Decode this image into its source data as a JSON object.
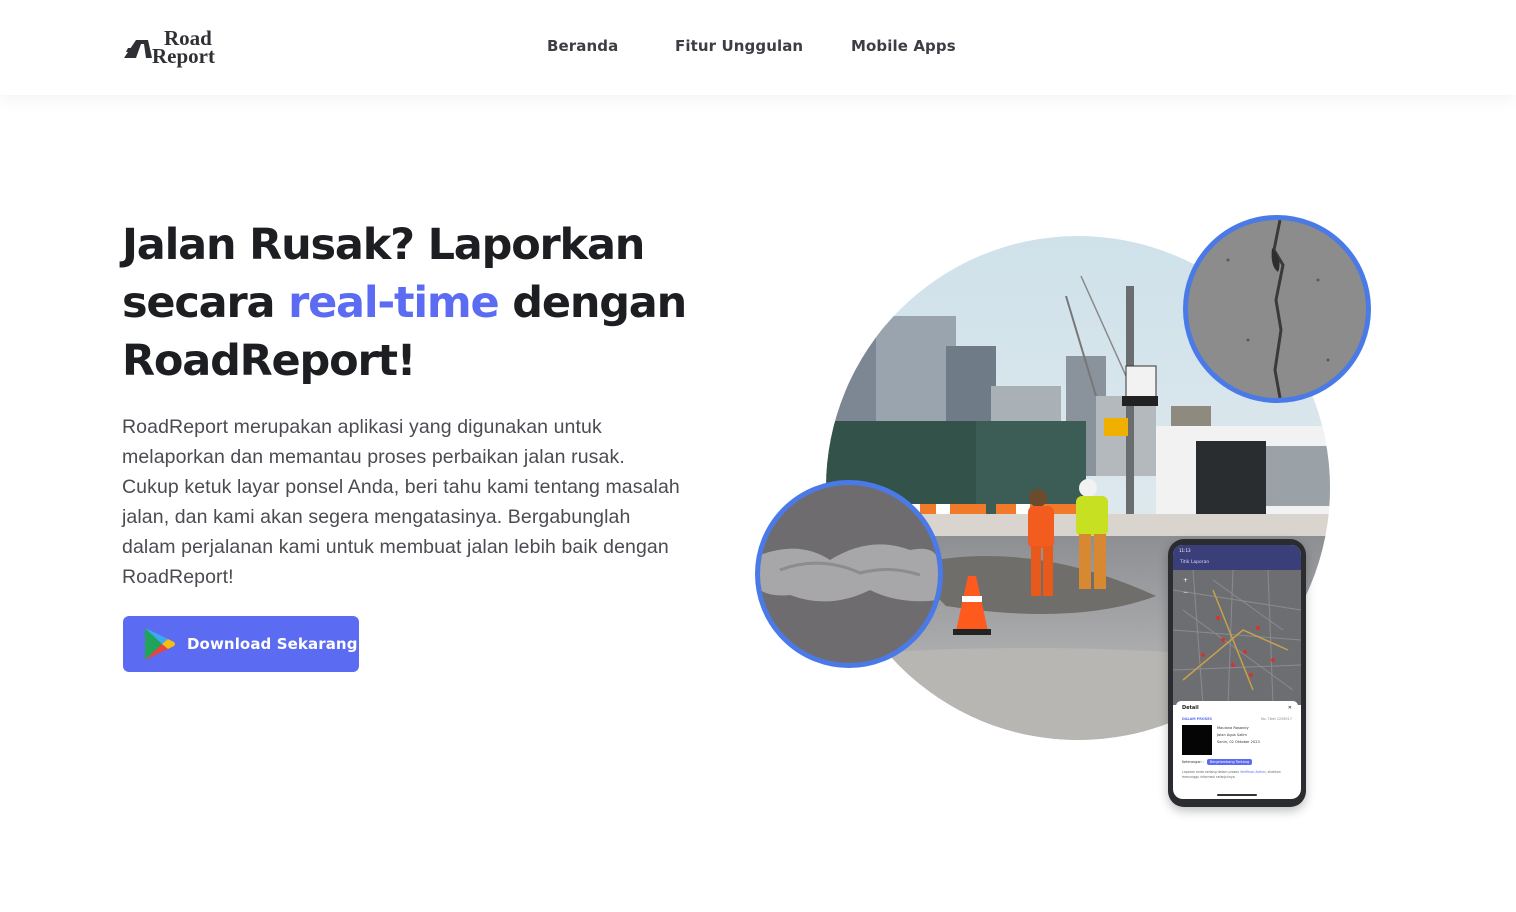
{
  "header": {
    "logo_text_top": "Road",
    "logo_text_bottom": "Report",
    "nav": [
      {
        "label": "Beranda"
      },
      {
        "label": "Fitur Unggulan"
      },
      {
        "label": "Mobile Apps"
      }
    ]
  },
  "hero": {
    "title_part1": "Jalan Rusak? Laporkan secara ",
    "title_accent": "real-time",
    "title_part2": " dengan RoadReport!",
    "description": "RoadReport merupakan aplikasi yang digunakan untuk melaporkan dan memantau proses perbaikan jalan rusak. Cukup ketuk layar ponsel Anda, beri tahu kami tentang masalah jalan, dan kami akan segera mengatasinya. Bergabunglah dalam perjalanan kami untuk membuat jalan lebih baik dengan RoadReport!",
    "cta_label": "Download Sekarang",
    "cta_icon": "google-play-icon"
  },
  "phone": {
    "status_time": "11:13",
    "app_title": "Titik Laporan",
    "detail_title": "Detail",
    "close_symbol": "✕",
    "status": "DALAM PROSES",
    "ticket": "No. Tiket 2256517",
    "reporter": "Maulana Rosandy",
    "address": "Jalan Agus Salim",
    "date": "Senin, 02 Oktober 2023",
    "note_label": "Keterangan :",
    "note_chip": "Bergelombang Tentang",
    "footer_text_before_link": "Laporan anda sedang dalam proses ",
    "footer_link": "Verifikasi Admin",
    "footer_text_after_link": ", silahkan menunggu informasi selanjutnya."
  },
  "colors": {
    "accent": "#5b6cf2",
    "circle_border": "#4a7ae8",
    "title": "#1d1e22",
    "body_text": "#4a4c52"
  }
}
